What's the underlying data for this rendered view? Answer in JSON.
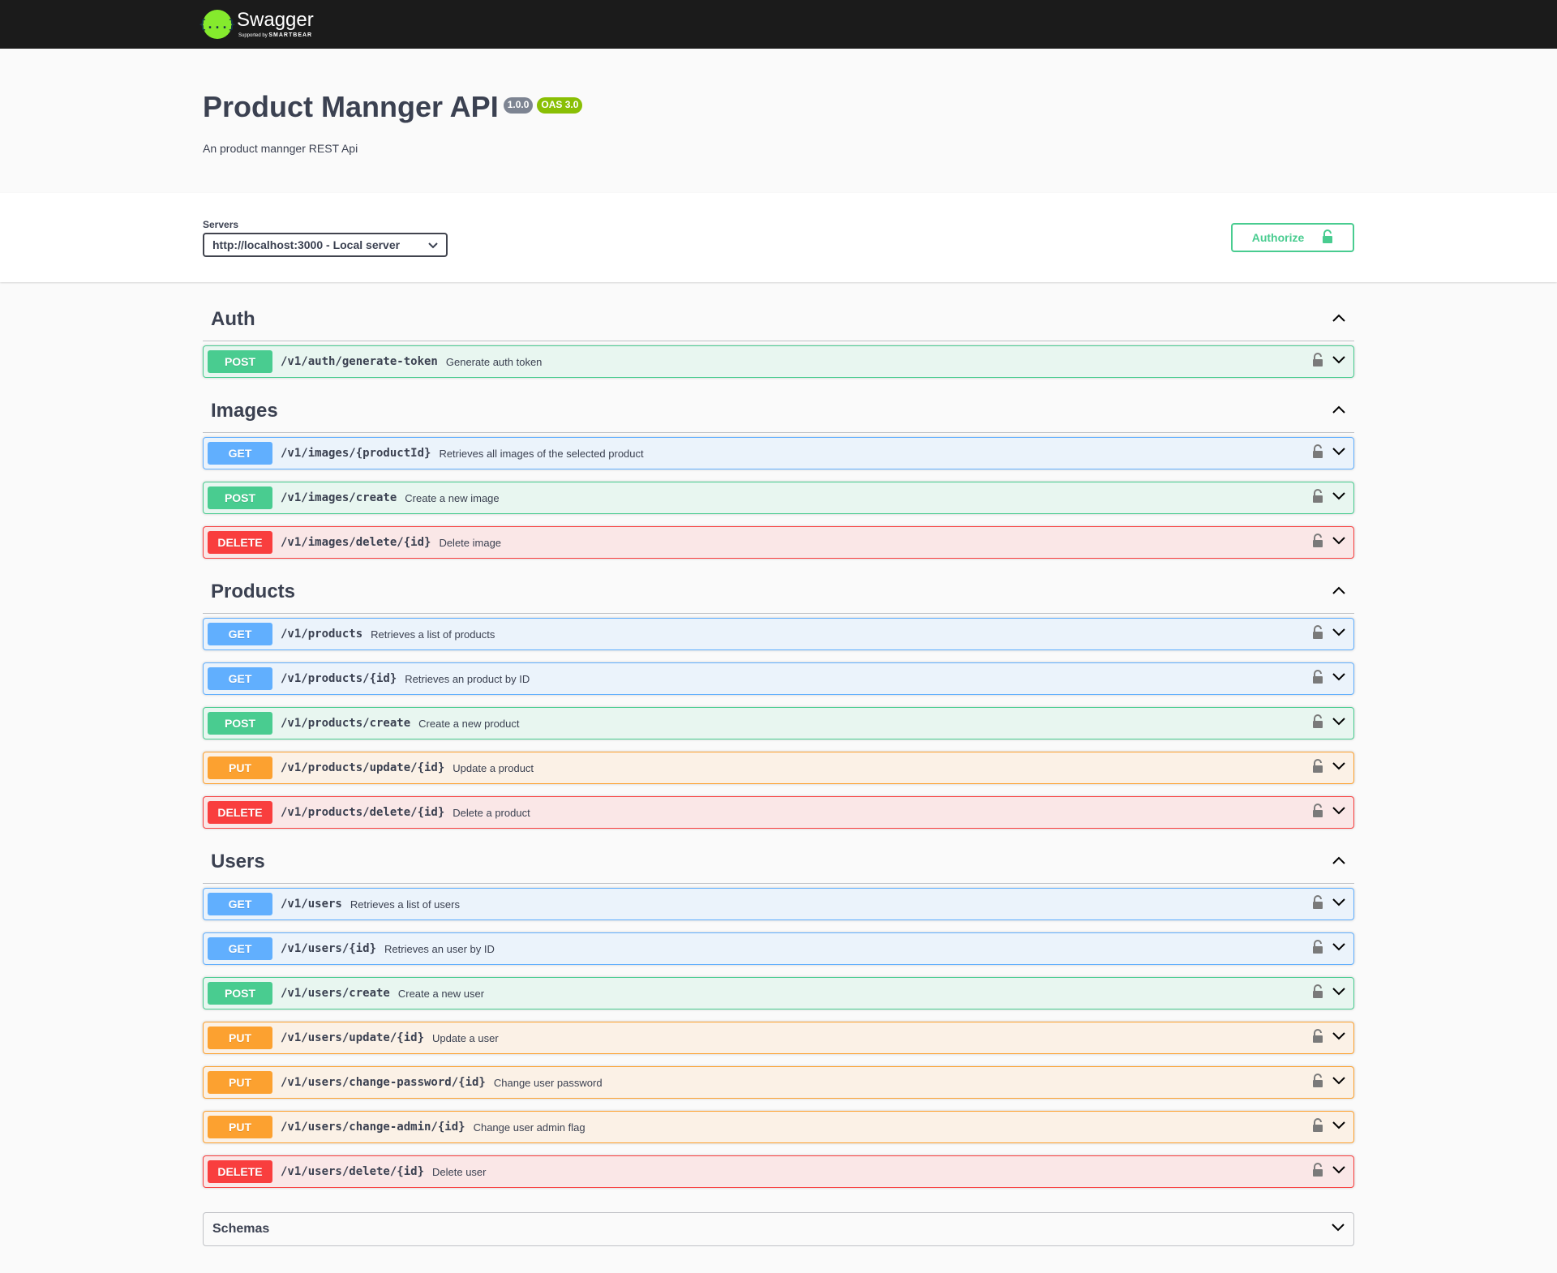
{
  "topbar": {
    "logo_name": "Swagger",
    "logo_sub_prefix": "Supported by",
    "logo_sub_brand": "SMARTBEAR",
    "logo_mark": "{...}"
  },
  "info": {
    "title": "Product Mannger API",
    "version": "1.0.0",
    "oas": "OAS 3.0",
    "description": "An product mannger REST Api"
  },
  "scheme": {
    "servers_label": "Servers",
    "selected_server": "http://localhost:3000 - Local server",
    "authorize_label": "Authorize"
  },
  "tags": [
    {
      "name": "Auth",
      "operations": [
        {
          "method": "POST",
          "path": "/v1/auth/generate-token",
          "summary": "Generate auth token"
        }
      ]
    },
    {
      "name": "Images",
      "operations": [
        {
          "method": "GET",
          "path": "/v1/images/{productId}",
          "summary": "Retrieves all images of the selected product"
        },
        {
          "method": "POST",
          "path": "/v1/images/create",
          "summary": "Create a new image"
        },
        {
          "method": "DELETE",
          "path": "/v1/images/delete/{id}",
          "summary": "Delete image"
        }
      ]
    },
    {
      "name": "Products",
      "operations": [
        {
          "method": "GET",
          "path": "/v1/products",
          "summary": "Retrieves a list of products"
        },
        {
          "method": "GET",
          "path": "/v1/products/{id}",
          "summary": "Retrieves an product by ID"
        },
        {
          "method": "POST",
          "path": "/v1/products/create",
          "summary": "Create a new product"
        },
        {
          "method": "PUT",
          "path": "/v1/products/update/{id}",
          "summary": "Update a product"
        },
        {
          "method": "DELETE",
          "path": "/v1/products/delete/{id}",
          "summary": "Delete a product"
        }
      ]
    },
    {
      "name": "Users",
      "operations": [
        {
          "method": "GET",
          "path": "/v1/users",
          "summary": "Retrieves a list of users"
        },
        {
          "method": "GET",
          "path": "/v1/users/{id}",
          "summary": "Retrieves an user by ID"
        },
        {
          "method": "POST",
          "path": "/v1/users/create",
          "summary": "Create a new user"
        },
        {
          "method": "PUT",
          "path": "/v1/users/update/{id}",
          "summary": "Update a user"
        },
        {
          "method": "PUT",
          "path": "/v1/users/change-password/{id}",
          "summary": "Change user password"
        },
        {
          "method": "PUT",
          "path": "/v1/users/change-admin/{id}",
          "summary": "Change user admin flag"
        },
        {
          "method": "DELETE",
          "path": "/v1/users/delete/{id}",
          "summary": "Delete user"
        }
      ]
    }
  ],
  "schemas": {
    "title": "Schemas"
  },
  "colors": {
    "get": "#61affe",
    "post": "#49cc90",
    "put": "#fca130",
    "delete": "#f93e3e",
    "topbar": "#1b1b1b",
    "accent_logo": "#85ea2d"
  },
  "icons": {
    "lock": "lock-icon",
    "expand": "chevron-down-icon",
    "collapse": "chevron-up-icon"
  }
}
